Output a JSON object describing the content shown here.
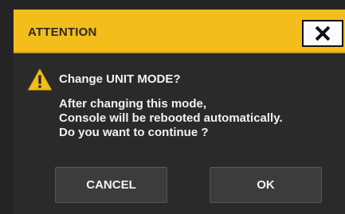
{
  "dialog": {
    "title": "ATTENTION",
    "close_icon": "close-x-icon",
    "warning_icon": "warning-triangle-icon",
    "headline": "Change UNIT MODE?",
    "message_lines": [
      "After changing this mode,",
      "Console will be rebooted automatically.",
      "Do you want to continue ?"
    ],
    "buttons": {
      "cancel": "CANCEL",
      "ok": "OK"
    }
  },
  "colors": {
    "title_bar": "#f3bd1b",
    "background": "#2a2a2a",
    "button": "#3c3c3c",
    "text": "#f2f2f2"
  }
}
